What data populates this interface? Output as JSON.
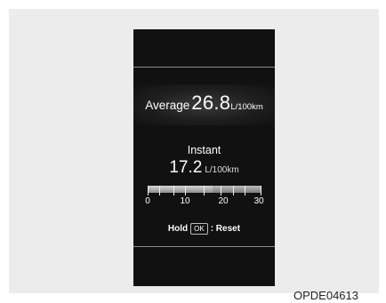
{
  "average": {
    "label": "Average",
    "value": "26.8",
    "unit": "L/100km"
  },
  "instant": {
    "label": "Instant",
    "value": "17.2",
    "unit": "L/100km",
    "level_fraction": 0.573
  },
  "gauge": {
    "ticks": [
      "0",
      "10",
      "20",
      "30"
    ]
  },
  "reset": {
    "prefix": "Hold",
    "key": "OK",
    "suffix": ": Reset"
  },
  "figure_code": "OPDE04613"
}
